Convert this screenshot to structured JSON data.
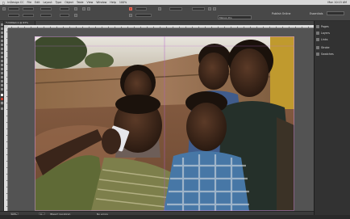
{
  "menu_bar": {
    "items": [
      "InDesign CC",
      "File",
      "Edit",
      "Layout",
      "Type",
      "Object",
      "Table",
      "View",
      "Window",
      "Help"
    ],
    "zoom": "100%",
    "clock": "Mon 10:15 AM"
  },
  "control_bar": {
    "stock_label": "Publish Online",
    "workspace": "Essentials",
    "font_field": "Minion Pro"
  },
  "document": {
    "tab_label": "*Untitled-1 @ 63%"
  },
  "panels": {
    "items": [
      "Pages",
      "Layers",
      "Links",
      "Stroke",
      "Swatches"
    ]
  },
  "status_bar": {
    "zoom": "63%",
    "page": "1",
    "profile": "[Basic] (working)",
    "preflight": "No errors"
  },
  "colors": {
    "app_bg": "#535353",
    "accent": "#c8402f"
  }
}
